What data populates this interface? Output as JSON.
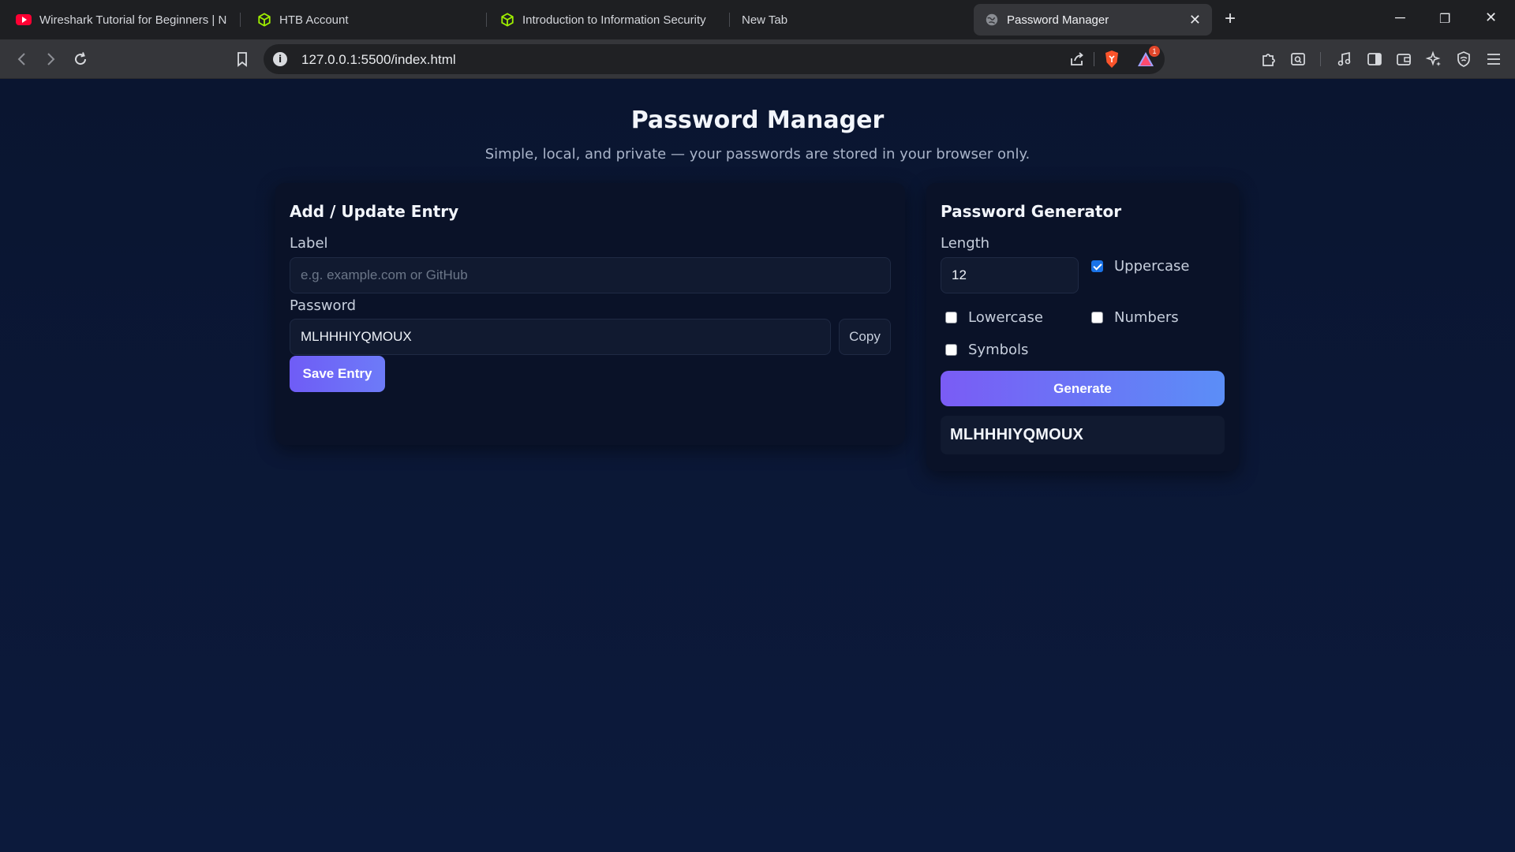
{
  "browser": {
    "tabs": [
      {
        "title": "Wireshark Tutorial for Beginners | Ne",
        "icon": "youtube-icon",
        "active": false
      },
      {
        "title": "HTB Account",
        "icon": "htb-cube-icon",
        "active": false
      },
      {
        "title": "Introduction to Information Security",
        "icon": "htb-cube-icon",
        "active": false
      },
      {
        "title": "New Tab",
        "icon": "",
        "active": false
      },
      {
        "title": "Password Manager",
        "icon": "globe-icon",
        "active": true
      }
    ],
    "url": "127.0.0.1:5500/index.html",
    "rewards_badge": "1",
    "accent": "#1a73e8"
  },
  "page": {
    "title": "Password Manager",
    "subtitle": "Simple, local, and private — your passwords are stored in your browser only."
  },
  "entry_form": {
    "heading": "Add / Update Entry",
    "label_field": {
      "label": "Label",
      "value": "",
      "placeholder": "e.g. example.com or GitHub"
    },
    "password_field": {
      "label": "Password",
      "value": "MLHHHIYQMOUX"
    },
    "copy_label": "Copy",
    "save_label": "Save Entry"
  },
  "generator": {
    "heading": "Password Generator",
    "length_label": "Length",
    "length_value": "12",
    "options": {
      "uppercase": {
        "label": "Uppercase",
        "checked": true
      },
      "lowercase": {
        "label": "Lowercase",
        "checked": false
      },
      "numbers": {
        "label": "Numbers",
        "checked": false
      },
      "symbols": {
        "label": "Symbols",
        "checked": false
      }
    },
    "generate_label": "Generate",
    "output": "MLHHHIYQMOUX",
    "button_gradient": [
      "#7a5cf5",
      "#5b8ef7"
    ]
  }
}
